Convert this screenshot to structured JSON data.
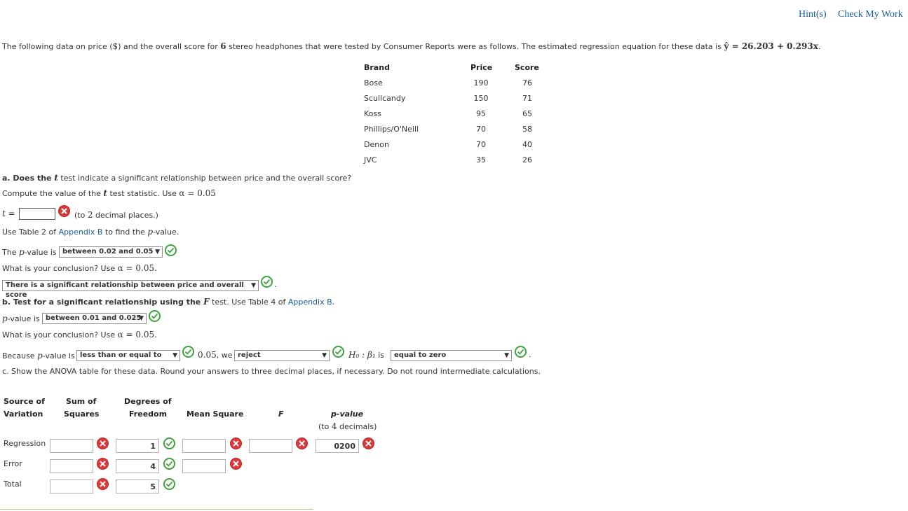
{
  "top_links": {
    "hints": "Hint(s)",
    "check": "Check My Work"
  },
  "intro": {
    "part1": "The following data on price (",
    "dollar": "$",
    "part2": ") and the overall score for ",
    "n": "6",
    "part3": " stereo headphones that were tested by Consumer Reports were as follows. The estimated regression equation for these data is ",
    "equation": "ŷ = 26.203 + 0.293x",
    "end": "."
  },
  "data_table": {
    "headers": [
      "Brand",
      "Price",
      "Score"
    ],
    "rows": [
      [
        "Bose",
        "190",
        "76"
      ],
      [
        "Scullcandy",
        "150",
        "71"
      ],
      [
        "Koss",
        "95",
        "65"
      ],
      [
        "Phillips/O'Neill",
        "70",
        "58"
      ],
      [
        "Denon",
        "70",
        "40"
      ],
      [
        "JVC",
        "35",
        "26"
      ]
    ]
  },
  "part_a": {
    "q1_prefix": "a. Does the ",
    "q1_var": "t",
    "q1_suffix": " test indicate a significant relationship between price and the overall score?",
    "q2_prefix": "Compute the value of the ",
    "q2_var": "t",
    "q2_mid": " test statistic. Use ",
    "q2_alpha": "α = 0.05",
    "t_label": "t =",
    "t_value": "",
    "t_note_pre": "(to ",
    "t_note_num": "2",
    "t_note_post": " decimal places.)",
    "table_pre": "Use Table 2 of ",
    "table_link": "Appendix B",
    "table_mid": " to find the ",
    "table_var": "p",
    "table_post": "-value.",
    "pval_pre": "The ",
    "pval_var": "p",
    "pval_post": "-value is",
    "pval_select": "between 0.02 and 0.05",
    "conc_q": "What is your conclusion? Use ",
    "conc_alpha": "α = 0.05.",
    "conc_select": "There is a significant relationship between price and overall score",
    "conc_end": "."
  },
  "part_b": {
    "q_pre": "b. Test for a significant relationship using the ",
    "q_var": "F",
    "q_mid": " test. Use Table 4 of ",
    "q_link": "Appendix B",
    "q_end": ".",
    "pval_var": "p",
    "pval_post": "-value is",
    "pval_select": "between 0.01 and 0.025",
    "conc_q": "What is your conclusion? Use ",
    "conc_alpha": "α = 0.05.",
    "because_pre": "Because ",
    "because_var": "p",
    "because_post": "-value is",
    "cmp_select": "less than or equal to",
    "alpha_val": "0.05",
    "we": ", we",
    "decision_select": "reject",
    "h0": "H₀ : β₁",
    "is": " is",
    "h0_select": "equal to zero",
    "end": "."
  },
  "part_c": {
    "q": "c. Show the ANOVA table for these data. Round your answers to three decimal places, if necessary. Do not round intermediate calculations."
  },
  "anova": {
    "headers": {
      "source": [
        "Source of",
        "Variation"
      ],
      "ss": [
        "Sum of",
        "Squares"
      ],
      "df": [
        "Degrees of",
        "Freedom"
      ],
      "ms": "Mean Square",
      "f": "F",
      "p": "p-value",
      "p_note_pre": "(to ",
      "p_note_num": "4",
      "p_note_post": " decimals)"
    },
    "rows": [
      {
        "source": "Regression",
        "ss": "",
        "df": "1",
        "ms": "",
        "f": "",
        "p": "0200"
      },
      {
        "source": "Error",
        "ss": "",
        "df": "4",
        "ms": ""
      },
      {
        "source": "Total",
        "ss": "",
        "df": "5"
      }
    ]
  },
  "colors": {
    "link": "#1a5a9e",
    "correct": "#3ea23e",
    "incorrect": "#d93b3b"
  }
}
